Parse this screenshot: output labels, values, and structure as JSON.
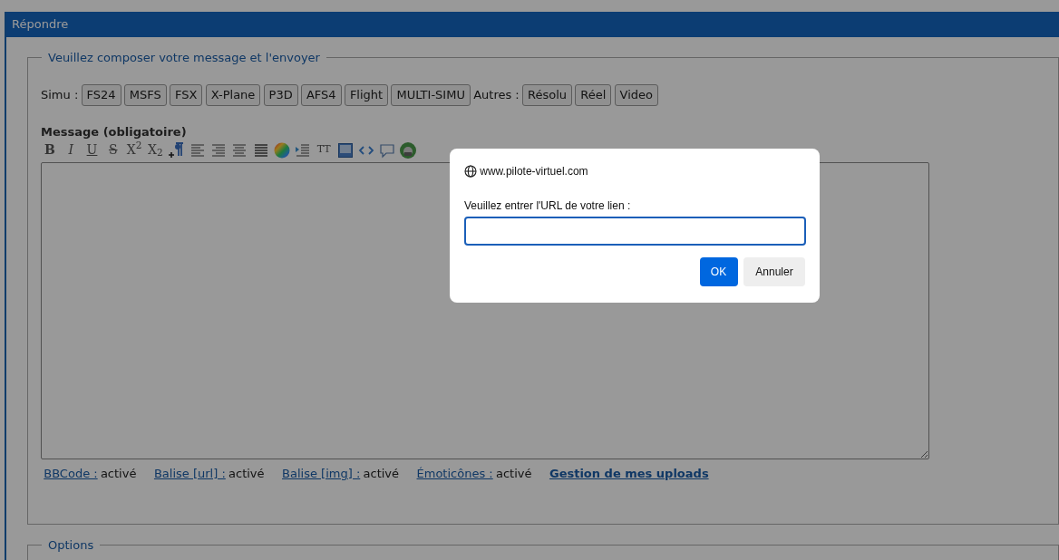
{
  "panel_title": "Répondre",
  "compose": {
    "legend": "Veuillez composer votre message et l'envoyer",
    "tag_groups": [
      {
        "label": "Simu :",
        "tags": [
          "FS24",
          "MSFS",
          "FSX",
          "X-Plane",
          "P3D",
          "AFS4",
          "Flight",
          "MULTI-SIMU"
        ]
      },
      {
        "label": "Autres :",
        "tags": [
          "Résolu",
          "Réel",
          "Video"
        ]
      }
    ],
    "message_label": "Message (obligatoire)",
    "toolbar": [
      {
        "kind": "bold",
        "label": "B"
      },
      {
        "kind": "italic",
        "label": "I"
      },
      {
        "kind": "underline",
        "label": "U"
      },
      {
        "kind": "strike",
        "label": "S"
      },
      {
        "kind": "superscript",
        "label": "X$^{2}$"
      },
      {
        "kind": "subscript",
        "label": "X$_{2}$"
      },
      {
        "kind": "paragraph"
      },
      {
        "kind": "align-left"
      },
      {
        "kind": "align-right"
      },
      {
        "kind": "align-center"
      },
      {
        "kind": "justify"
      },
      {
        "kind": "color-wheel"
      },
      {
        "kind": "indent"
      },
      {
        "kind": "font-size",
        "label": "TT"
      },
      {
        "kind": "image"
      },
      {
        "kind": "code"
      },
      {
        "kind": "speech-bubble"
      },
      {
        "kind": "avatar"
      }
    ],
    "status": [
      {
        "label": "BBCode :",
        "value": "activé"
      },
      {
        "label": "Balise [url] :",
        "value": "activé"
      },
      {
        "label": "Balise [img] :",
        "value": "activé"
      },
      {
        "label": "Émoticônes :",
        "value": "activé"
      }
    ],
    "uploads_link": "Gestion de mes uploads"
  },
  "options_legend": "Options",
  "dialog": {
    "origin": "www.pilote-virtuel.com",
    "prompt": "Veuillez entrer l'URL de votre lien :",
    "buttons": [
      {
        "label": "OK",
        "primary": true
      },
      {
        "label": "Annuler",
        "primary": false
      }
    ]
  }
}
